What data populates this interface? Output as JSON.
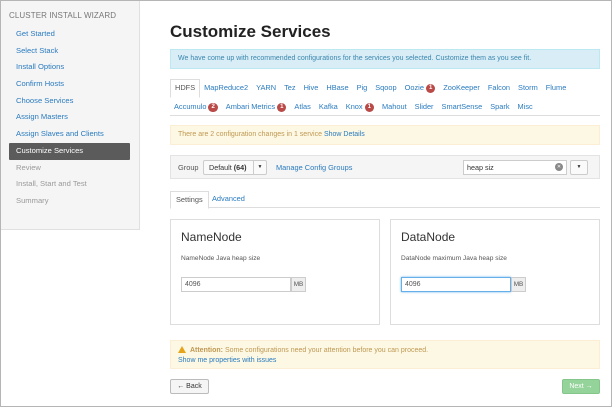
{
  "sidebar": {
    "title": "CLUSTER INSTALL WIZARD",
    "items": [
      {
        "label": "Get Started"
      },
      {
        "label": "Select Stack"
      },
      {
        "label": "Install Options"
      },
      {
        "label": "Confirm Hosts"
      },
      {
        "label": "Choose Services"
      },
      {
        "label": "Assign Masters"
      },
      {
        "label": "Assign Slaves and Clients"
      },
      {
        "label": "Customize Services"
      },
      {
        "label": "Review"
      },
      {
        "label": "Install, Start and Test"
      },
      {
        "label": "Summary"
      }
    ]
  },
  "main": {
    "title": "Customize Services",
    "info_text": "We have come up with recommended configurations for the services you selected. Customize them as you see fit.",
    "tabs_row1": [
      {
        "label": "HDFS"
      },
      {
        "label": "MapReduce2"
      },
      {
        "label": "YARN"
      },
      {
        "label": "Tez"
      },
      {
        "label": "Hive"
      },
      {
        "label": "HBase"
      },
      {
        "label": "Pig"
      },
      {
        "label": "Sqoop"
      },
      {
        "label": "Oozie",
        "badge": "1"
      },
      {
        "label": "ZooKeeper"
      },
      {
        "label": "Falcon"
      },
      {
        "label": "Storm"
      },
      {
        "label": "Flume"
      }
    ],
    "tabs_row2": [
      {
        "label": "Accumulo",
        "badge": "2"
      },
      {
        "label": "Ambari Metrics",
        "badge": "1"
      },
      {
        "label": "Atlas"
      },
      {
        "label": "Kafka"
      },
      {
        "label": "Knox",
        "badge": "1"
      },
      {
        "label": "Mahout"
      },
      {
        "label": "Slider"
      },
      {
        "label": "SmartSense"
      },
      {
        "label": "Spark"
      },
      {
        "label": "Misc"
      }
    ],
    "changes_text": "There are 2 configuration changes in 1 service",
    "show_details": "Show Details",
    "group_label": "Group",
    "group_value": "Default",
    "group_count": "(64)",
    "manage_groups": "Manage Config Groups",
    "filter_value": "heap siz",
    "subtabs": {
      "settings": "Settings",
      "advanced": "Advanced"
    },
    "namenode": {
      "title": "NameNode",
      "label": "NameNode Java heap size",
      "value": "4096",
      "unit": "MB"
    },
    "datanode": {
      "title": "DataNode",
      "label": "DataNode maximum Java heap size",
      "value": "4096",
      "unit": "MB"
    },
    "attention_title": "Attention:",
    "attention_text": "Some configurations need your attention before you can proceed.",
    "attention_link": "Show me properties with issues",
    "back_label": "← Back",
    "next_label": "Next →"
  }
}
